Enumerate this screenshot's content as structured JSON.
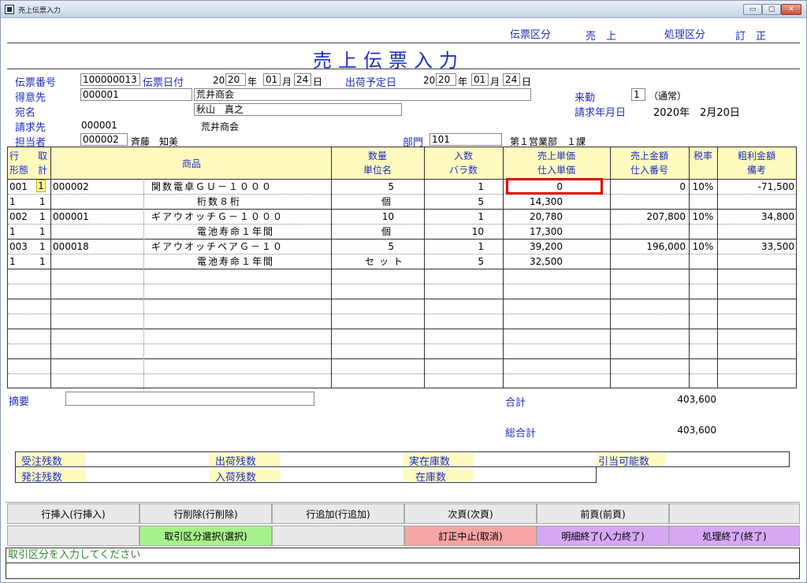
{
  "window": {
    "title": "売上伝票入力",
    "controls": [
      "▭",
      "▢",
      "✕"
    ]
  },
  "header": {
    "denpyo_kubun_label": "伝票区分",
    "denpyo_kubun_value": "売　上",
    "shori_kubun_label": "処理区分",
    "shori_kubun_value": "訂　正",
    "form_title": "売上伝票入力"
  },
  "form": {
    "denpyo_no_label": "伝票番号",
    "denpyo_no": "100000013",
    "denpyo_date_label": "伝票日付",
    "denpyo_date_prefix": "20",
    "denpyo_year": "20",
    "year_label": "年",
    "denpyo_month": "01",
    "month_label": "月",
    "denpyo_day": "24",
    "day_label": "日",
    "ship_date_label": "出荷予定日",
    "ship_date_prefix": "20",
    "ship_year": "20",
    "ship_month": "01",
    "ship_day": "24",
    "tokuisaki_label": "得意先",
    "tokuisaki_code": "000001",
    "tokuisaki_name": "荒井商会",
    "atena_label": "宛名",
    "atena": "秋山　真之",
    "raikin_label": "来勤",
    "raikin_value": "1",
    "raikin_note": "（通常）",
    "seikyu_date_label": "請求年月日",
    "seikyu_date": "2020年　2月20日",
    "seikyusaki_label": "請求先",
    "seikyusaki_code": "000001",
    "seikyusaki_name": "荒井商会",
    "tantosha_label": "担当者",
    "tantosha_code": "000002",
    "tantosha_name": "斉藤　知美",
    "bumon_label": "部門",
    "bumon_code": "101",
    "bumon_name": "第１営業部　１課"
  },
  "grid": {
    "headers": {
      "gyo": "行",
      "tori": "取",
      "keitai": "形態",
      "kei": "計",
      "shohin": "商品",
      "suryo": "数量",
      "tani": "単位名",
      "irisu": "入数",
      "bara": "バラ数",
      "uri_tanka": "売上単価",
      "shiire_tanka": "仕入単価",
      "uri_kingaku": "売上金額",
      "shiire_no": "仕入番号",
      "zeiritsu": "税率",
      "arari": "粗利金額",
      "biko": "備考"
    },
    "rows": [
      {
        "gyo": "001",
        "tori": "1",
        "code": "000002",
        "name": "関数電卓ＧＵ－１０００",
        "suryo": "5",
        "irisu": "1",
        "uri_tanka": "0",
        "uri_kingaku": "0",
        "zei": "10%",
        "arari": "-71,500",
        "keitai": "1",
        "kei": "1",
        "desc": "桁数８桁",
        "tani": "個",
        "bara": "5",
        "shiire_tanka": "14,300"
      },
      {
        "gyo": "002",
        "tori": "1",
        "code": "000001",
        "name": "ギアウオッチＧ－１０００",
        "suryo": "10",
        "irisu": "1",
        "uri_tanka": "20,780",
        "uri_kingaku": "207,800",
        "zei": "10%",
        "arari": "34,800",
        "keitai": "1",
        "kei": "1",
        "desc": "電池寿命１年間",
        "tani": "個",
        "bara": "10",
        "shiire_tanka": "17,300"
      },
      {
        "gyo": "003",
        "tori": "1",
        "code": "000018",
        "name": "ギアウオッチペアＧ－１０",
        "suryo": "5",
        "irisu": "1",
        "uri_tanka": "39,200",
        "uri_kingaku": "196,000",
        "zei": "10%",
        "arari": "33,500",
        "keitai": "1",
        "kei": "1",
        "desc": "電池寿命１年間",
        "tani": "セット",
        "bara": "5",
        "shiire_tanka": "32,500"
      }
    ]
  },
  "summary": {
    "tekiyo_label": "摘要",
    "tekiyo_value": "",
    "gokei_label": "合計",
    "gokei": "403,600",
    "sogokei_label": "総合計",
    "sogokei": "403,600"
  },
  "stock": {
    "juchu_label": "受注残数",
    "hatchu_label": "発注残数",
    "shukka_label": "出荷残数",
    "nyuka_label": "入荷残数",
    "jitsuzaiko_label": "実在庫数",
    "zaiko_label": "在庫数",
    "hikiate_label": "引当可能数"
  },
  "buttons": {
    "row1": [
      "行挿入(行挿入)",
      "行削除(行削除)",
      "行追加(行追加)",
      "次頁(次頁)",
      "前頁(前頁)",
      ""
    ],
    "row2": [
      "",
      "取引区分選択(選択)",
      "",
      "訂正中止(取消)",
      "明細終了(入力終了)",
      "処理終了(終了)"
    ]
  },
  "status": {
    "message": "取引区分を入力してください"
  },
  "colors": {
    "accent_blue": "#1d2fc4",
    "header_yellow": "#fffbbf",
    "highlight_red": "#e00000",
    "btn_green": "#a6f28a",
    "btn_red": "#f6a4a4",
    "btn_purple": "#d6a8f4"
  }
}
